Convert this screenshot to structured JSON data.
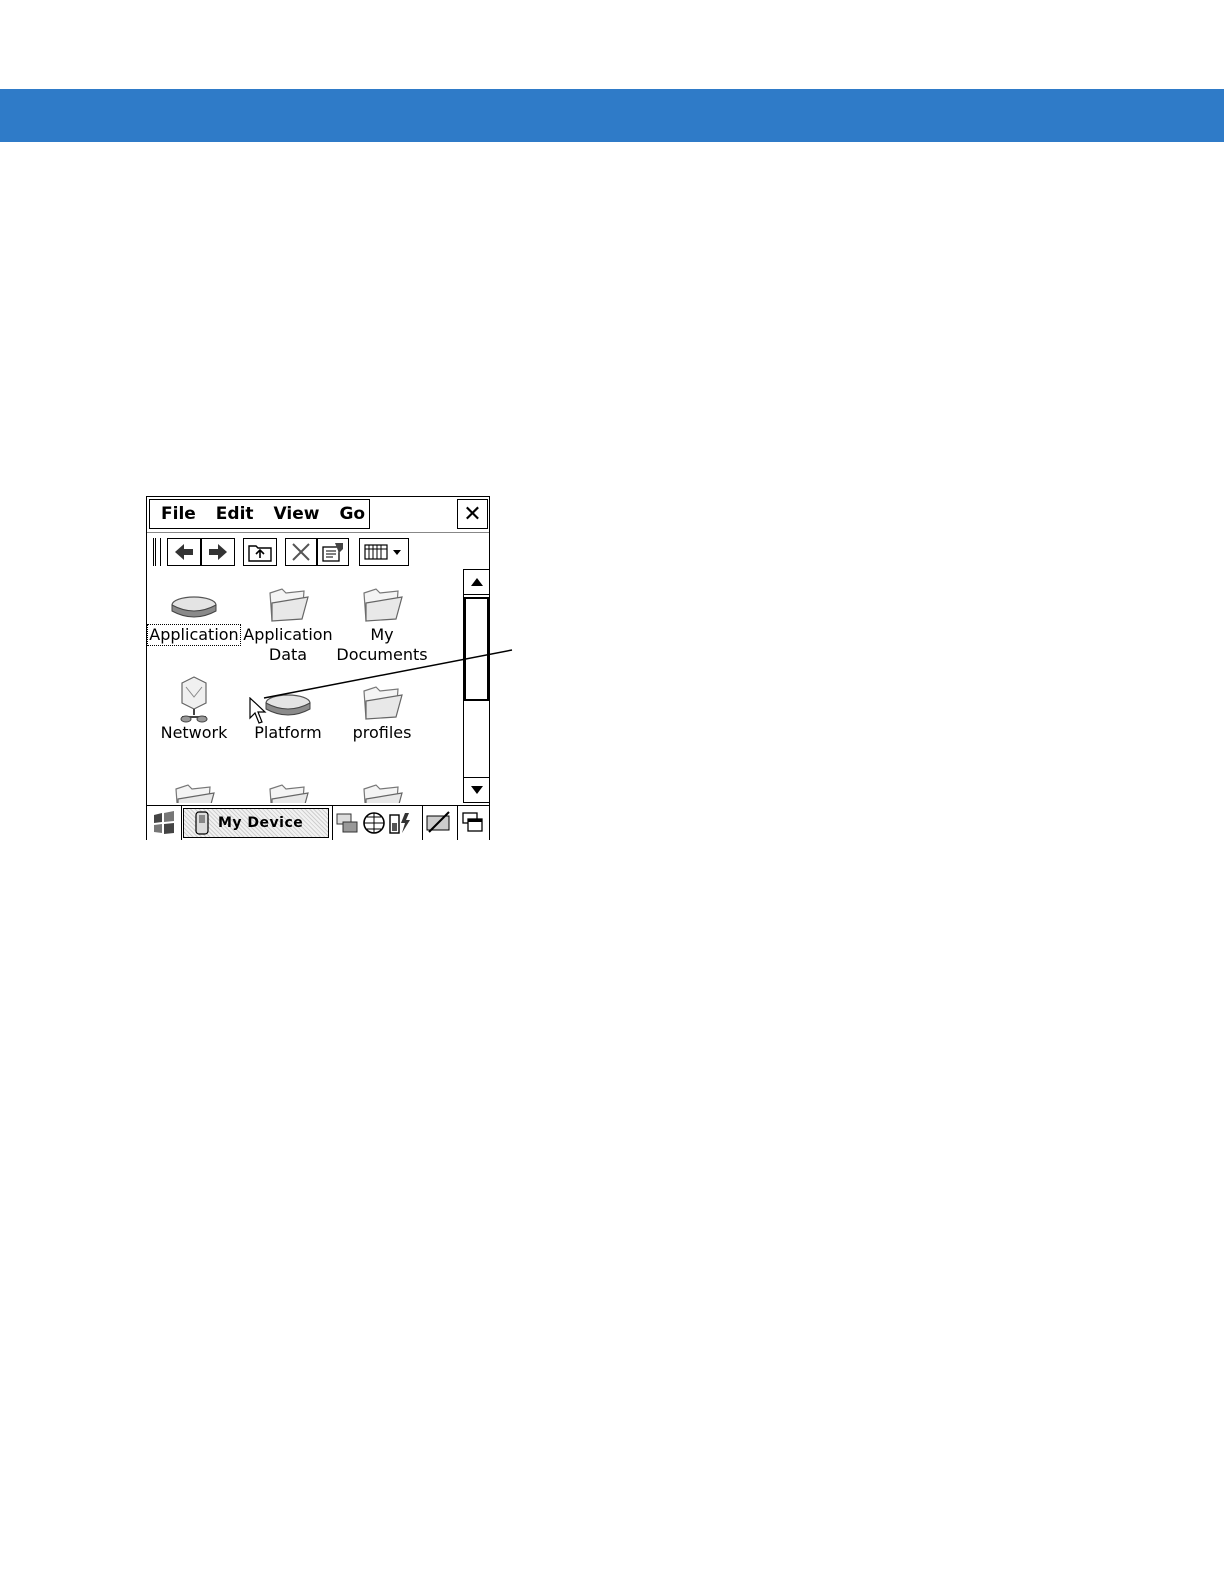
{
  "menu": {
    "file": "File",
    "edit": "Edit",
    "view": "View",
    "go": "Go",
    "close_glyph": "✕"
  },
  "toolbar": {
    "icons": [
      "grip",
      "back-arrow-icon",
      "forward-arrow-icon",
      "folder-up-icon",
      "delete-icon",
      "properties-icon",
      "view-mode-icon"
    ]
  },
  "items": [
    {
      "label": "Application",
      "icon": "drive-icon",
      "selected": true
    },
    {
      "label": "Application Data",
      "line1": "Application",
      "line2": "Data",
      "icon": "folder-icon"
    },
    {
      "label": "My Documents",
      "line1": "My",
      "line2": "Documents",
      "icon": "folder-icon"
    },
    {
      "label": "Network",
      "icon": "network-icon"
    },
    {
      "label": "Platform",
      "icon": "drive-icon"
    },
    {
      "label": "profiles",
      "icon": "folder-icon"
    }
  ],
  "taskbar": {
    "active_task": "My Device",
    "tray_icons": [
      "network-status-icon",
      "connection-globe-icon",
      "battery-icon",
      "input-panel-icon",
      "windows-icon"
    ]
  },
  "colors": {
    "banner": "#2f7bc8"
  }
}
